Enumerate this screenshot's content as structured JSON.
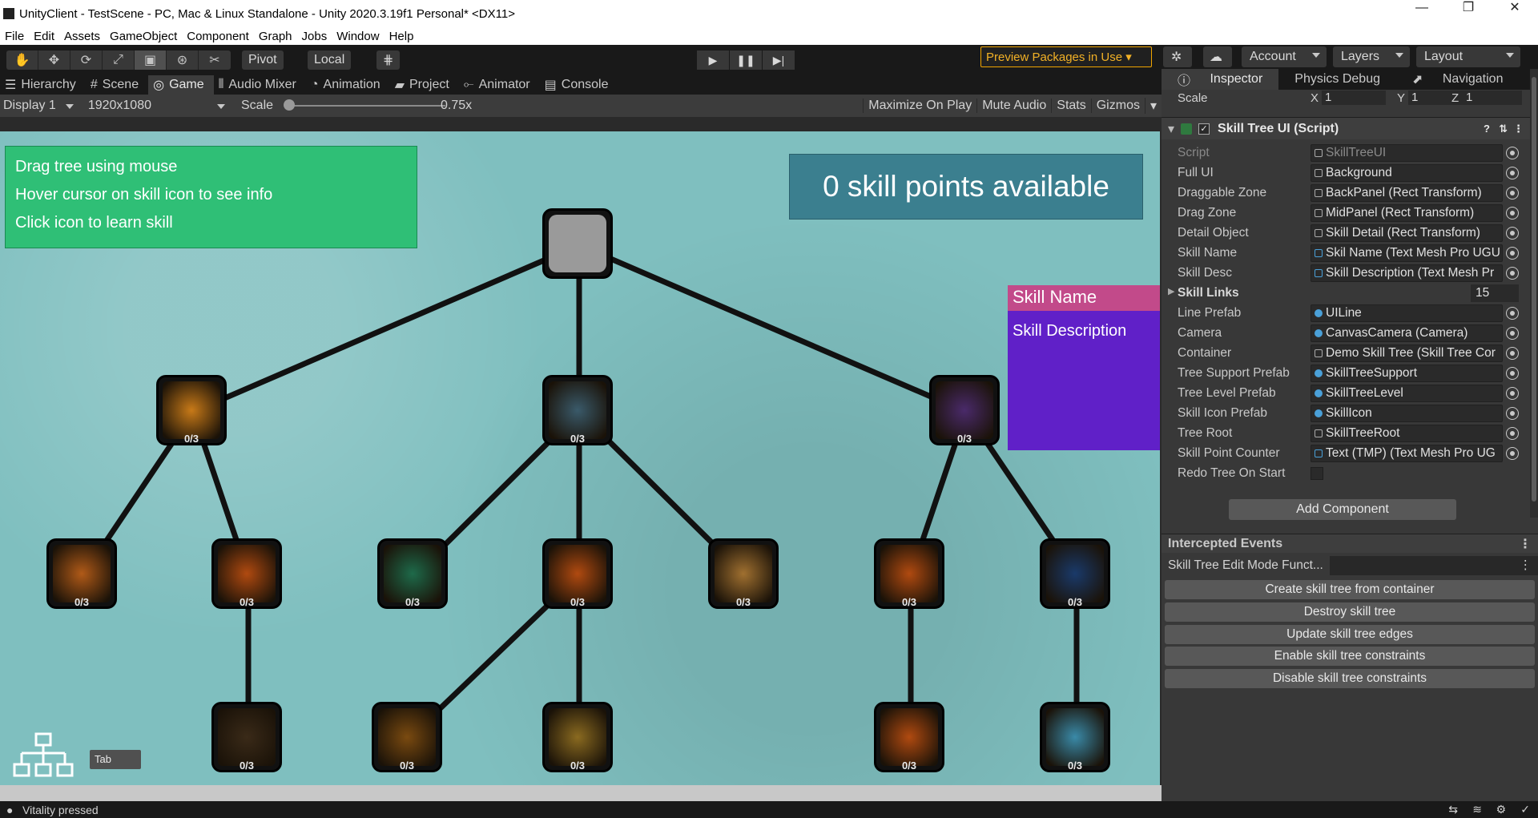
{
  "window": {
    "title": "UnityClient - TestScene - PC, Mac & Linux Standalone - Unity 2020.3.19f1 Personal* <DX11>",
    "controls": [
      "—",
      "❐",
      "✕"
    ]
  },
  "menu": [
    "File",
    "Edit",
    "Assets",
    "GameObject",
    "Component",
    "Graph",
    "Jobs",
    "Window",
    "Help"
  ],
  "toolbar": {
    "pivot": "Pivot",
    "local": "Local",
    "preview_packages": "Preview Packages in Use",
    "account": "Account",
    "layers": "Layers",
    "layout": "Layout"
  },
  "panel_tabs": [
    "Hierarchy",
    "Scene",
    "Game",
    "Audio Mixer",
    "Animation",
    "Project",
    "Animator",
    "Console"
  ],
  "game_bar": {
    "display": "Display 1",
    "resolution": "1920x1080",
    "scale_label": "Scale",
    "scale_value": "0.75x",
    "maximize": "Maximize On Play",
    "mute": "Mute Audio",
    "stats": "Stats",
    "gizmos": "Gizmos"
  },
  "game": {
    "info_lines": [
      "Drag tree using mouse",
      "Hover cursor on skill icon to see info",
      "Click icon to learn skill"
    ],
    "skill_points": "0 skill points available",
    "detail_name": "Skill Name",
    "detail_desc": "Skill Description",
    "level_label": "0/3",
    "tab_label": "Tab",
    "skill_colors": [
      "#c87a18",
      "#3a5a6a",
      "#4a2a6a",
      "#b05a18",
      "#b04a10",
      "#1e6a4a",
      "#b04a10",
      "#a07030",
      "#b04a10",
      "#1a3a6a",
      "#3a2a18",
      "#7a4a10",
      "#8a6a20",
      "#b04a10",
      "#3a8aa8"
    ]
  },
  "inspector": {
    "tabs": [
      "Inspector",
      "Physics Debug",
      "Navigation"
    ],
    "scale_label": "Scale",
    "scale_x": "1",
    "scale_y": "1",
    "scale_z": "1",
    "component_title": "Skill Tree UI (Script)",
    "fields": [
      {
        "label": "Script",
        "value": "SkillTreeUI"
      },
      {
        "label": "Full UI",
        "value": "Background"
      },
      {
        "label": "Draggable Zone",
        "value": "BackPanel (Rect Transform)"
      },
      {
        "label": "Drag Zone",
        "value": "MidPanel (Rect Transform)"
      },
      {
        "label": "Detail Object",
        "value": "Skill Detail (Rect Transform)"
      },
      {
        "label": "Skill Name",
        "value": "Skil Name (Text Mesh Pro UGU"
      },
      {
        "label": "Skill Desc",
        "value": "Skill Description (Text Mesh Pr"
      },
      {
        "label": "Skill Links",
        "value": "15"
      },
      {
        "label": "Line Prefab",
        "value": "UILine"
      },
      {
        "label": "Camera",
        "value": "CanvasCamera (Camera)"
      },
      {
        "label": "Container",
        "value": "Demo Skill Tree (Skill Tree Cor"
      },
      {
        "label": "Tree Support Prefab",
        "value": "SkillTreeSupport"
      },
      {
        "label": "Tree Level Prefab",
        "value": "SkillTreeLevel"
      },
      {
        "label": "Skill Icon Prefab",
        "value": "SkillIcon"
      },
      {
        "label": "Tree Root",
        "value": "SkillTreeRoot"
      },
      {
        "label": "Skill Point Counter",
        "value": "Text (TMP) (Text Mesh Pro UG"
      },
      {
        "label": "Redo Tree On Start",
        "value": ""
      }
    ],
    "add_component": "Add Component",
    "intercepted_events": "Intercepted Events",
    "edit_mode_tab": "Skill Tree Edit Mode Funct...",
    "buttons": [
      "Create skill tree from container",
      "Destroy skill tree",
      "Update skill tree edges",
      "Enable skill tree constraints",
      "Disable skill tree constraints"
    ]
  },
  "status": "Vitality pressed"
}
